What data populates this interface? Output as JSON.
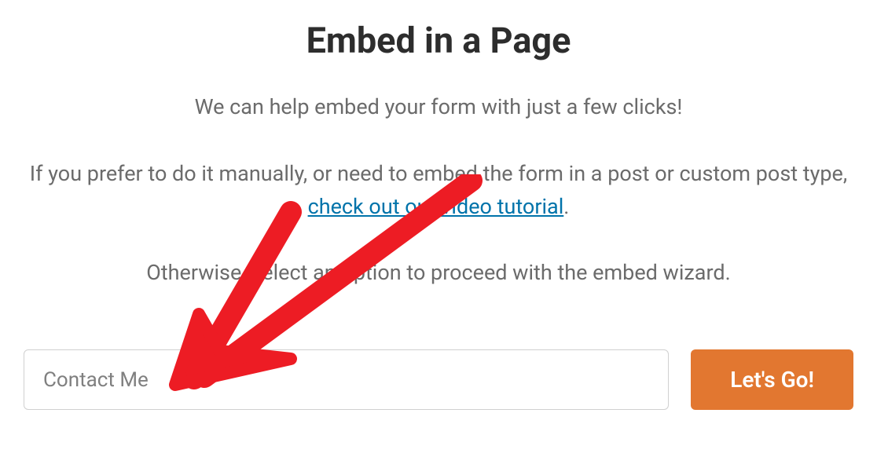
{
  "modal": {
    "title": "Embed in a Page",
    "subtitle": "We can help embed your form with just a few clicks!",
    "description_before_link": "If you prefer to do it manually, or need to embed the form in a post or custom post type, ",
    "link_text": "check out our video tutorial",
    "description_after_link": ".",
    "instruction": "Otherwise, select an option to proceed with the embed wizard.",
    "input_value": "Contact Me",
    "button_label": "Let's Go!"
  }
}
